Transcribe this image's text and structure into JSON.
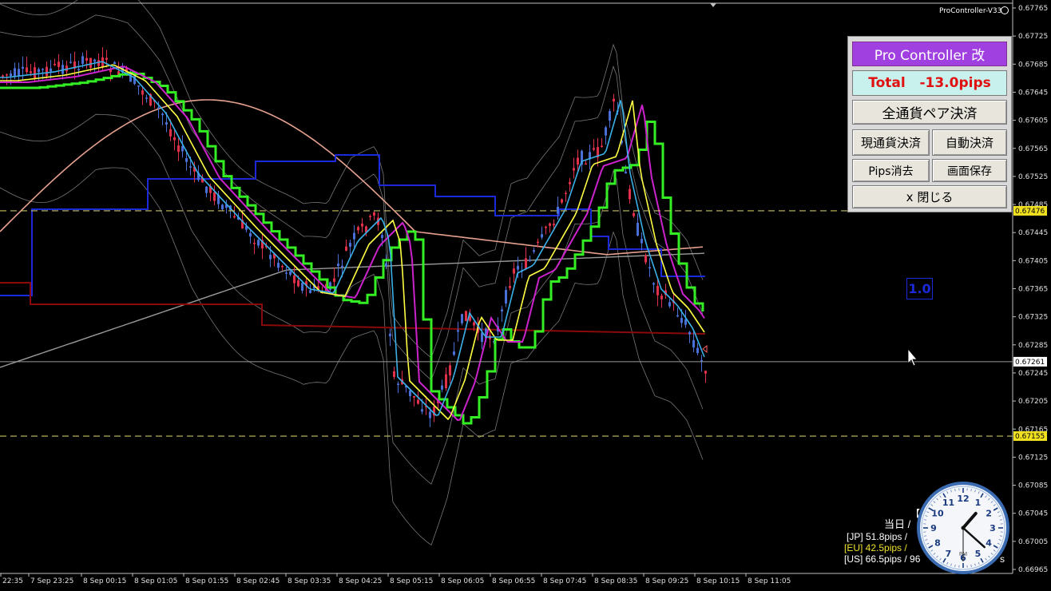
{
  "window": {
    "indicator_name": "ProController-V33"
  },
  "colors": {
    "background": "#000000",
    "bull_candle": "#4a6fd6",
    "bear_candle": "#e0304a",
    "ma_fast": "#3ab0e8",
    "ma_yellow": "#ffff44",
    "ma_magenta": "#cc22cc",
    "ma_green": "#33ee22",
    "ma_salmon": "#e6a090",
    "donchian_blue": "#1a2ad8",
    "donchian_darkred": "#8a0a0a",
    "bollinger": "#777777",
    "long_ma_gray": "#9a9a9a",
    "dashed_level": "#c8c060",
    "panel_title_bg": "#a040e0",
    "panel_total_bg": "#c8f0ec",
    "panel_total_text": "#e01010"
  },
  "price_axis": {
    "ticks": [
      "0.67765",
      "0.67725",
      "0.67685",
      "0.67645",
      "0.67605",
      "0.67565",
      "0.67525",
      "0.67485",
      "0.67445",
      "0.67405",
      "0.67365",
      "0.67325",
      "0.67285",
      "0.67245",
      "0.67205",
      "0.67165",
      "0.67125",
      "0.67085",
      "0.67045",
      "0.67005",
      "0.66965"
    ],
    "labels": [
      {
        "text": "0.67476",
        "kind": "level"
      },
      {
        "text": "0.67261",
        "kind": "current"
      },
      {
        "text": "0.67155",
        "kind": "level"
      }
    ]
  },
  "time_axis": {
    "labels": [
      "22:35",
      "7 Sep 23:25",
      "8 Sep 00:15",
      "8 Sep 01:05",
      "8 Sep 01:55",
      "8 Sep 02:45",
      "8 Sep 03:35",
      "8 Sep 04:25",
      "8 Sep 05:15",
      "8 Sep 06:05",
      "8 Sep 06:55",
      "8 Sep 07:45",
      "8 Sep 08:35",
      "8 Sep 09:25",
      "8 Sep 10:15",
      "8 Sep 11:05"
    ]
  },
  "panel": {
    "title": "Pro Controller 改",
    "total": "Total   -13.0pips",
    "close_all_pairs": "全通貨ペア決済",
    "close_current_pair": "現通貨決済",
    "auto_close": "自動決済",
    "delete_pips": "Pips消去",
    "save_screen": "画面保存",
    "close_panel": "x 閉じる"
  },
  "lot_label": "1.0",
  "stats": {
    "header": "【7",
    "today": "当日 /",
    "jp": "[JP] 51.8pips /",
    "eu": "[EU] 42.5pips /",
    "us": "[US] 66.5pips / 96",
    "us_suffix": "s"
  },
  "clock": {
    "numerals": [
      "12",
      "1",
      "2",
      "3",
      "4",
      "5",
      "6",
      "7",
      "8",
      "9",
      "10",
      "11"
    ],
    "ampm": "PM",
    "time": "1:22:30"
  }
}
